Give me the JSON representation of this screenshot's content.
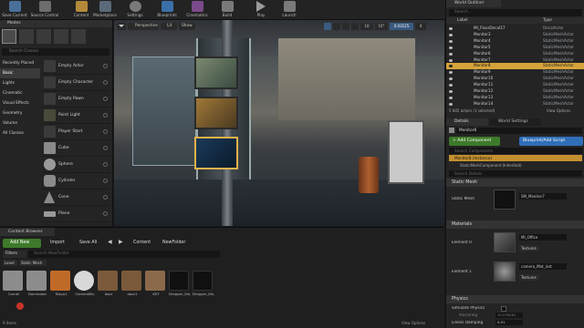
{
  "toolbar": {
    "buttons": [
      {
        "label": "Save Current",
        "color": "#4a6f9b"
      },
      {
        "label": "Source Control",
        "color": "#6d6d6d"
      },
      {
        "label": "Content",
        "color": "#b48a3a"
      },
      {
        "label": "Marketplace",
        "color": "#5a6a7a"
      },
      {
        "label": "Settings",
        "color": "#7a7a7a"
      },
      {
        "label": "Blueprints",
        "color": "#3b6fa8"
      },
      {
        "label": "Cinematics",
        "color": "#7a4a8a"
      },
      {
        "label": "Build",
        "color": "#7a7a7a"
      },
      {
        "label": "Play",
        "color": "#7a7a7a"
      },
      {
        "label": "Launch",
        "color": "#7a7a7a"
      }
    ]
  },
  "modes": {
    "title": "Modes",
    "search_placeholder": "Search Classes",
    "categories": [
      "Recently Placed",
      "Basic",
      "Lights",
      "Cinematic",
      "Visual Effects",
      "Geometry",
      "Volume",
      "All Classes"
    ],
    "items": [
      "Empty Actor",
      "Empty Character",
      "Empty Pawn",
      "Point Light",
      "Player Start",
      "Cube",
      "Sphere",
      "Cylinder",
      "Cone",
      "Plane"
    ]
  },
  "viewport": {
    "perspective_label": "Perspective",
    "lit_label": "Lit",
    "show_label": "Show",
    "grid_value": "10",
    "rot_value": "10°",
    "scale_value": "0.03125",
    "cam_value": "4"
  },
  "content_browser": {
    "tab_title": "Content Browser",
    "add_new": "Add New",
    "import": "Import",
    "save_all": "Save All",
    "path_root": "Content",
    "path_folder": "NewFolder",
    "filters": "Filters",
    "search_placeholder": "Search NewFolder",
    "chips": [
      "Level",
      "Static Mesh"
    ],
    "assets": [
      {
        "label": "Cornel",
        "color": "#8c8c8c"
      },
      {
        "label": "Dominator",
        "color": "#8c8c8c"
      },
      {
        "label": "Tokyo1",
        "color": "#c06a28"
      },
      {
        "label": "CameraBlu",
        "color": "#d8d8d8"
      },
      {
        "label": "door",
        "color": "#7a5a3a"
      },
      {
        "label": "door1",
        "color": "#7a5a3a"
      },
      {
        "label": "KEY",
        "color": "#8a6a4a"
      },
      {
        "label": "Dropper_lite_unitmetallic",
        "color": "#101010"
      },
      {
        "label": "Dropper_lite_unitmetallic",
        "color": "#101010"
      }
    ],
    "footer": "9 items",
    "view_options": "View Options"
  },
  "outliner": {
    "title": "World Outliner",
    "search_placeholder": "Search...",
    "col_label": "Label",
    "col_type": "Type",
    "rows": [
      {
        "name": "MI_FloorDecal17",
        "type": "DecalActor"
      },
      {
        "name": "Monitor3",
        "type": "StaticMeshActor"
      },
      {
        "name": "Monitor4",
        "type": "StaticMeshActor"
      },
      {
        "name": "Monitor5",
        "type": "StaticMeshActor"
      },
      {
        "name": "Monitor6",
        "type": "StaticMeshActor"
      },
      {
        "name": "Monitor7",
        "type": "StaticMeshActor"
      },
      {
        "name": "Monitor8",
        "type": "StaticMeshActor"
      },
      {
        "name": "Monitor9",
        "type": "StaticMeshActor"
      },
      {
        "name": "Monitor10",
        "type": "StaticMeshActor"
      },
      {
        "name": "Monitor11",
        "type": "StaticMeshActor"
      },
      {
        "name": "Monitor12",
        "type": "StaticMeshActor"
      },
      {
        "name": "Monitor13",
        "type": "StaticMeshActor"
      },
      {
        "name": "Monitor14",
        "type": "StaticMeshActor"
      }
    ],
    "selected_index": 6,
    "footer": "5 845 actors (1 selected)",
    "view_options": "View Options"
  },
  "details": {
    "tabs": [
      "Details",
      "World Settings"
    ],
    "object_name": "Monitor8",
    "add_component": "+ Add Component",
    "blueprint": "Blueprint/Add Script",
    "search_components": "Search Components",
    "instance_label": "Monitor8 (Instance)",
    "child_label": "StaticMeshComponent (Inherited)",
    "search_details": "Search Details",
    "static_mesh_section": "Static Mesh",
    "static_mesh_label": "Static Mesh",
    "static_mesh_value": "SM_Monitor7",
    "materials_section": "Materials",
    "element0_label": "Element 0",
    "element0_value": "MI_Office",
    "element1_label": "Element 1",
    "element1_value": "camera_Mat_inst",
    "textures_label": "Textures",
    "physics_section": "Physics",
    "simulate_label": "Simulate Physics",
    "mass_label": "MassInKg",
    "mass_value": "10.078461",
    "damping_label": "Linear Damping",
    "damping_value": "0.01"
  }
}
